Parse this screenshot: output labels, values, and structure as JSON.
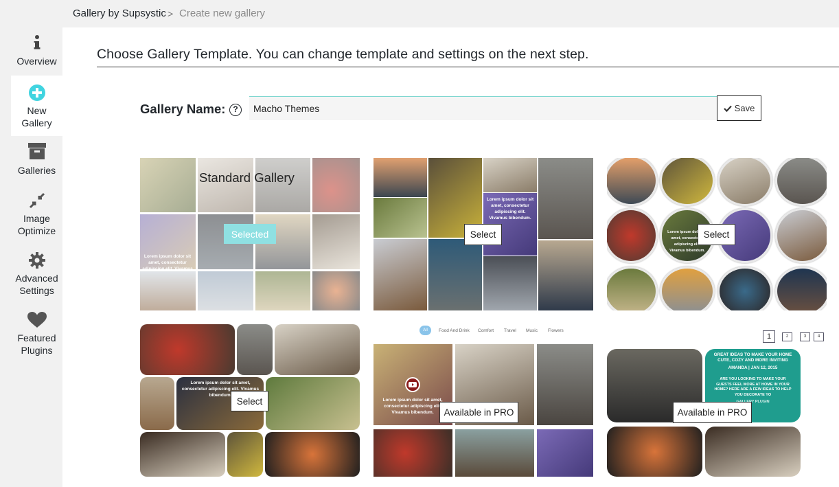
{
  "breadcrumb": {
    "root": "Gallery by Supsystic",
    "separator": ">",
    "current": "Create new gallery"
  },
  "sidebar": {
    "items": [
      {
        "label": "Overview",
        "icon": "info-icon"
      },
      {
        "label_line1": "New",
        "label_line2": "Gallery",
        "icon": "plus-circle-icon",
        "active": true
      },
      {
        "label": "Galleries",
        "icon": "archive-box-icon"
      },
      {
        "label_line1": "Image",
        "label_line2": "Optimize",
        "icon": "compress-arrows-icon"
      },
      {
        "label_line1": "Advanced",
        "label_line2": "Settings",
        "icon": "gear-icon"
      },
      {
        "label_line1": "Featured",
        "label_line2": "Plugins",
        "icon": "heart-icon"
      }
    ]
  },
  "main": {
    "heading": "Choose Gallery Template. You can change template and settings on the next step.",
    "name_label": "Gallery Name:",
    "help_glyph": "?",
    "name_value": "Macho Themes",
    "save_label": "Save",
    "accent_color": "#7fd7d0"
  },
  "templates": [
    {
      "title": "Standard Gallery",
      "button": "Selected",
      "state": "selected"
    },
    {
      "button": "Select"
    },
    {
      "button": "Select"
    },
    {
      "button": "Select"
    },
    {
      "button": "Available in PRO",
      "filters": [
        "All",
        "Food And Drink",
        "Comfort",
        "Travel",
        "Music",
        "Flowers"
      ],
      "caption": "Lorem ipsum dolor sit amet, consectetur adipiscing elit. Vivamus bibendum."
    },
    {
      "button": "Available in PRO",
      "pages": [
        "1",
        "2",
        "3",
        "4"
      ],
      "card_title": "GREAT IDEAS TO MAKE YOUR HOME CUTE, COZY AND MORE INVITING",
      "card_byline": "AMANDA | JAN 12, 2015",
      "card_body": "ARE YOU LOOKING TO MAKE YOUR GUESTS FEEL MORE AT HOME IN YOUR HOME? HERE ARE A FEW IDEAS TO HELP YOU DECORATE YO",
      "card_footer": "GALLERY PLUGIN"
    }
  ],
  "tile_captions": {
    "t1": "Lorem ipsum dolor sit amet, consectetur adipiscing elit. Vivamus bibendum.",
    "t2": "Lorem ipsum dolor sit amet, consectetur adipiscing elit. Vivamus bibendum.",
    "t3": "Lorem ipsum dolor sit amet, consectetur adipiscing elit. Vivamus bibendum.",
    "t4": "Lorem ipsum dolor sit amet, consectetur adipiscing elit. Vivamus bibendum."
  }
}
